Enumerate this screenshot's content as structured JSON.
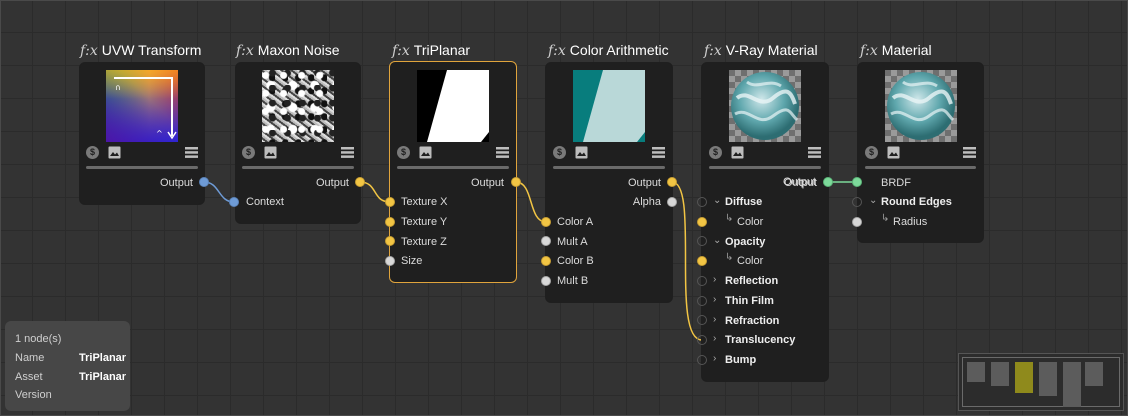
{
  "nodes": {
    "uvw": {
      "fx": "f:x",
      "title": "UVW Transform",
      "output": "Output"
    },
    "noise": {
      "fx": "f:x",
      "title": "Maxon Noise",
      "output": "Output",
      "input": "Context"
    },
    "tri": {
      "fx": "f:x",
      "title": "TriPlanar",
      "output": "Output",
      "inputs": [
        "Texture X",
        "Texture Y",
        "Texture Z",
        "Size"
      ]
    },
    "color": {
      "fx": "f:x",
      "title": "Color Arithmetic",
      "outputs": [
        "Output",
        "Alpha"
      ],
      "inputs": [
        "Color A",
        "Mult A",
        "Color B",
        "Mult B"
      ]
    },
    "vray": {
      "fx": "f:x",
      "title": "V-Ray Material",
      "output": "Output",
      "inputs": [
        "Diffuse",
        "Color",
        "Opacity",
        "Color",
        "Reflection",
        "Thin Film",
        "Refraction",
        "Translucency",
        "Bump"
      ]
    },
    "mat": {
      "fx": "f:x",
      "title": "Material",
      "output": "Output",
      "inputs": [
        "BRDF",
        "Round Edges",
        "Radius"
      ]
    }
  },
  "info": {
    "count": "1 node(s)",
    "name_label": "Name",
    "name_value": "TriPlanar",
    "asset_label": "Asset",
    "asset_value": "TriPlanar",
    "version_label": "Version"
  },
  "colors": {
    "port_yellow": "#f2c544",
    "port_blue": "#6e9bd6",
    "port_green": "#7dd99a",
    "selected_border": "#e0a43c",
    "minimap_highlight": "#8f8a1c"
  },
  "icons": [
    "coin-icon",
    "image-icon",
    "menu-icon",
    "chevron-right-icon",
    "chevron-down-icon"
  ]
}
